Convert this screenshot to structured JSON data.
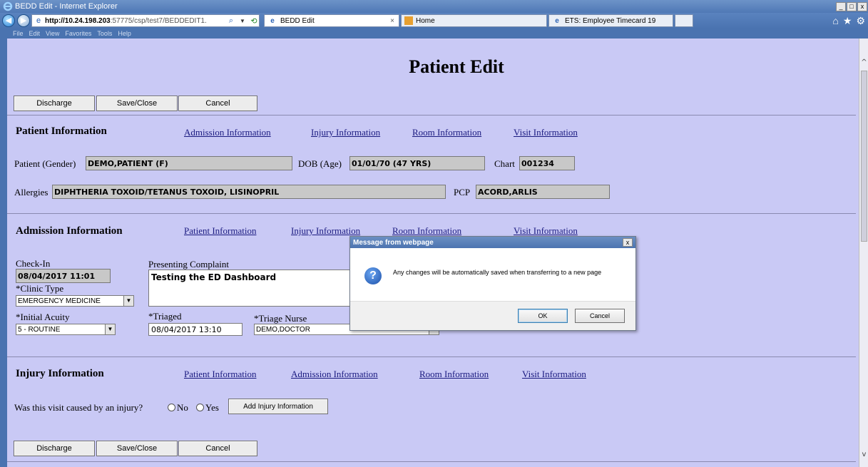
{
  "browser": {
    "title": "BEDD Edit - Internet Explorer",
    "url_host": "http://10.24.198.203",
    "url_rest": ":57775/csp/test7/BEDDEDIT1.",
    "tabs": [
      {
        "label": "BEDD Edit",
        "close": "×"
      },
      {
        "label": "Home"
      },
      {
        "label": "ETS: Employee Timecard 19"
      }
    ],
    "menu": [
      "File",
      "Edit",
      "View",
      "Favorites",
      "Tools",
      "Help"
    ],
    "window_buttons": [
      "_",
      "□",
      "x"
    ]
  },
  "page": {
    "title": "Patient Edit",
    "buttons": {
      "discharge": "Discharge",
      "save_close": "Save/Close",
      "cancel": "Cancel"
    }
  },
  "patient_info": {
    "heading": "Patient Information",
    "links": [
      "Admission Information",
      "Injury Information",
      "Room Information",
      "Visit Information"
    ],
    "patient_label": "Patient (Gender)",
    "patient_value": "DEMO,PATIENT (F)",
    "dob_label": "DOB (Age)",
    "dob_value": "01/01/70 (47 YRS)",
    "chart_label": "Chart",
    "chart_value": "001234",
    "allergies_label": "Allergies",
    "allergies_value": "DIPHTHERIA TOXOID/TETANUS TOXOID, LISINOPRIL",
    "pcp_label": "PCP",
    "pcp_value": "ACORD,ARLIS"
  },
  "admission_info": {
    "heading": "Admission Information",
    "links": [
      "Patient Information",
      "Injury Information",
      "Room Information",
      "Visit Information"
    ],
    "checkin_label": "Check-In",
    "checkin_value": "08/04/2017 11:01",
    "complaint_label": "Presenting Complaint",
    "complaint_value": "Testing the ED Dashboard",
    "clinic_label": "*Clinic Type",
    "clinic_value": "EMERGENCY MEDICINE",
    "acuity_label": "*Initial Acuity",
    "acuity_value": "5 - ROUTINE",
    "triaged_label": "*Triaged",
    "triaged_value": "08/04/2017 13:10",
    "nurse_label": "*Triage Nurse",
    "nurse_value": "DEMO,DOCTOR"
  },
  "injury_info": {
    "heading": "Injury Information",
    "links": [
      "Patient Information",
      "Admission Information",
      "Room Information",
      "Visit Information"
    ],
    "question": "Was this visit caused by an injury?",
    "no_label": "No",
    "yes_label": "Yes",
    "add_button": "Add Injury Information"
  },
  "dialog": {
    "title": "Message from webpage",
    "message": "Any changes will be automatically saved when transferring to a new page",
    "ok": "OK",
    "cancel": "Cancel",
    "close": "x"
  }
}
